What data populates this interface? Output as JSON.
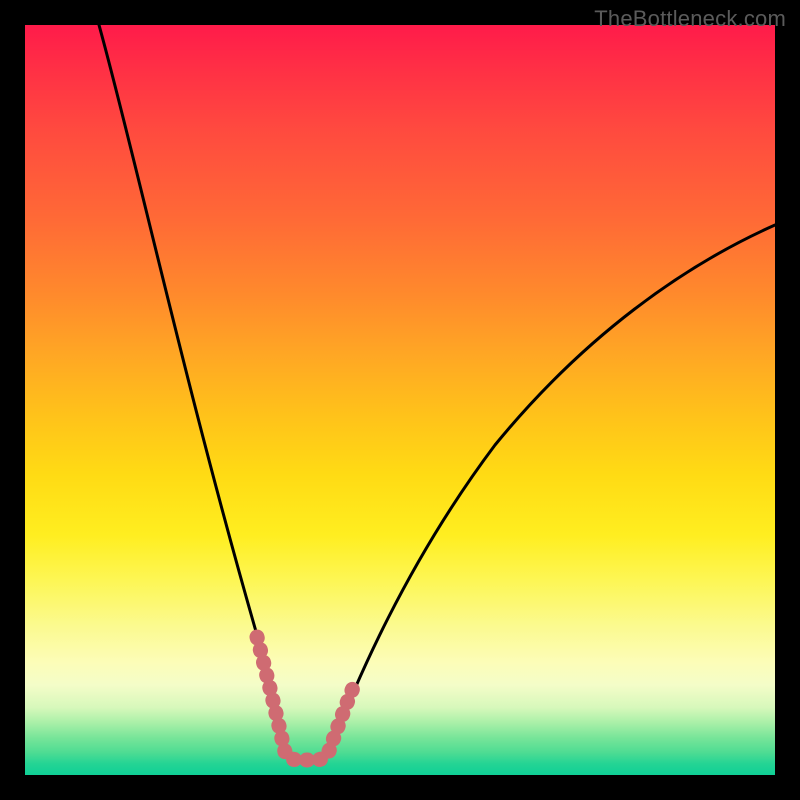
{
  "watermark": "TheBottleneck.com",
  "chart_data": {
    "type": "line",
    "title": "",
    "xlabel": "",
    "ylabel": "",
    "xlim": [
      0,
      100
    ],
    "ylim": [
      0,
      100
    ],
    "grid": false,
    "series": [
      {
        "name": "bottleneck-curve",
        "x": [
          10,
          12,
          14,
          16,
          18,
          20,
          22,
          24,
          26,
          28,
          30,
          31,
          32,
          33,
          34,
          35,
          36,
          37,
          38,
          39,
          40,
          42,
          44,
          48,
          52,
          58,
          66,
          74,
          82,
          90,
          100
        ],
        "values": [
          100,
          93,
          86,
          79,
          72,
          65,
          58,
          51,
          44,
          37,
          30,
          24,
          18,
          12,
          6,
          3,
          3,
          3,
          4,
          7,
          10,
          15,
          20,
          28,
          35,
          44,
          53,
          61,
          66,
          70,
          74
        ]
      }
    ],
    "highlight": {
      "name": "valley-band",
      "color": "#cf6b72",
      "x": [
        30.5,
        31.2,
        32.0,
        33.0,
        33.8,
        34.6,
        35.0,
        35.8,
        36.6,
        37.4,
        38.2,
        39.0,
        39.5
      ],
      "values": [
        24,
        18,
        12,
        7,
        4,
        3,
        3,
        3,
        3,
        4,
        6,
        9,
        12
      ]
    },
    "gradient_bands": [
      {
        "position": 0,
        "color": "#ff1b4a"
      },
      {
        "position": 50,
        "color": "#ffd61a"
      },
      {
        "position": 88,
        "color": "#fcfdb8"
      },
      {
        "position": 100,
        "color": "#0fd096"
      }
    ]
  }
}
